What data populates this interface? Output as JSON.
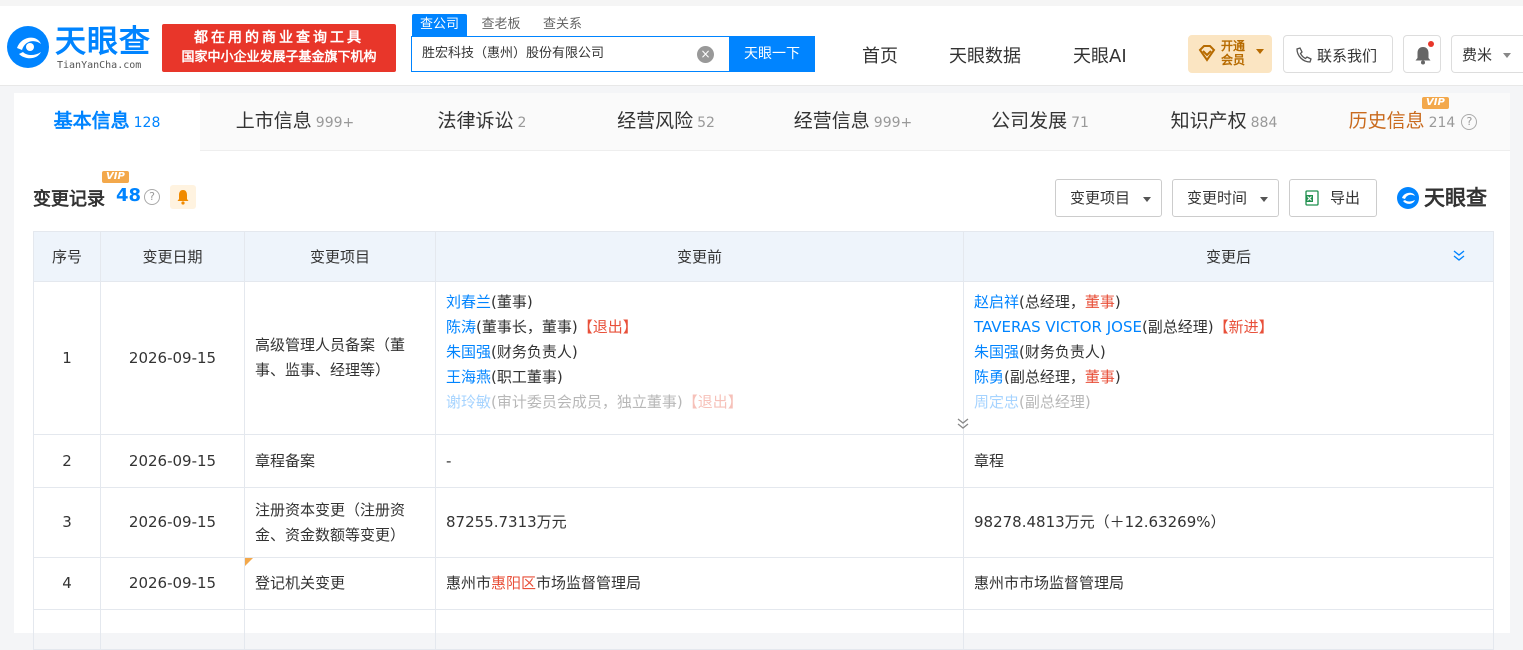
{
  "header": {
    "logo_text": "天眼查",
    "logo_sub": "TianYanCha.com",
    "promo_line1": "都在用的商业查询工具",
    "promo_line2": "国家中小企业发展子基金旗下机构",
    "search_tabs": [
      "查公司",
      "查老板",
      "查关系"
    ],
    "search_value": "胜宏科技（惠州）股份有限公司",
    "search_button": "天眼一下",
    "nav": [
      "首页",
      "天眼数据",
      "天眼AI"
    ],
    "vip_label_1": "开通",
    "vip_label_2": "会员",
    "contact_label": "联系我们",
    "user_name": "费米"
  },
  "tabs": [
    {
      "label": "基本信息",
      "count": "128"
    },
    {
      "label": "上市信息",
      "count": "999+"
    },
    {
      "label": "法律诉讼",
      "count": "2"
    },
    {
      "label": "经营风险",
      "count": "52"
    },
    {
      "label": "经营信息",
      "count": "999+"
    },
    {
      "label": "公司发展",
      "count": "71"
    },
    {
      "label": "知识产权",
      "count": "884"
    },
    {
      "label": "历史信息",
      "count": "214"
    }
  ],
  "vip_tag": "VIP",
  "section": {
    "title": "变更记录",
    "count": "48",
    "btn_item": "变更项目",
    "btn_time": "变更时间",
    "btn_export": "导出",
    "watermark": "天眼查"
  },
  "table": {
    "headers": [
      "序号",
      "变更日期",
      "变更项目",
      "变更前",
      "变更后"
    ],
    "rows": [
      {
        "no": "1",
        "date": "2026-09-15",
        "item": "高级管理人员备案（董事、监事、经理等）",
        "before": [
          {
            "name": "刘春兰",
            "role": "(董事)",
            "tag": ""
          },
          {
            "name": "陈涛",
            "role": "(董事长，董事)",
            "tag": "【退出】"
          },
          {
            "name": "朱国强",
            "role": "(财务负责人)",
            "tag": ""
          },
          {
            "name": "王海燕",
            "role": "(职工董事)",
            "tag": ""
          },
          {
            "name": "谢玲敏",
            "role": "(审计委员会成员，独立董事)",
            "tag": "【退出】"
          }
        ],
        "after": [
          {
            "name": "赵启祥",
            "role_a": "(总经理",
            "role_hl": "董事",
            "role_b": ")",
            "tag": ""
          },
          {
            "name": "TAVERAS VICTOR JOSE",
            "role_a": "(副总经理)",
            "role_hl": "",
            "role_b": "",
            "tag": "【新进】"
          },
          {
            "name": "朱国强",
            "role_a": "(财务负责人)",
            "role_hl": "",
            "role_b": "",
            "tag": ""
          },
          {
            "name": "陈勇",
            "role_a": "(副总经理",
            "role_hl": "董事",
            "role_b": ")",
            "tag": ""
          },
          {
            "name": "周定忠",
            "role_a": "(副总经理)",
            "role_hl": "",
            "role_b": "",
            "tag": ""
          }
        ]
      },
      {
        "no": "2",
        "date": "2026-09-15",
        "item": "章程备案",
        "before": "-",
        "after": "章程"
      },
      {
        "no": "3",
        "date": "2026-09-15",
        "item": "注册资本变更（注册资金、资金数额等变更）",
        "before": "87255.7313万元",
        "after": "98278.4813万元（＋12.63269%）"
      },
      {
        "no": "4",
        "date": "2026-09-15",
        "item": "登记机关变更",
        "before_a": "惠州市",
        "before_hl": "惠阳区",
        "before_b": "市场监督管理局",
        "after": "惠州市市场监督管理局"
      }
    ]
  },
  "colors": {
    "brand": "#0084ff",
    "promo": "#e8362a",
    "highlight": "#e8503a",
    "vip": "#f3a84b"
  }
}
